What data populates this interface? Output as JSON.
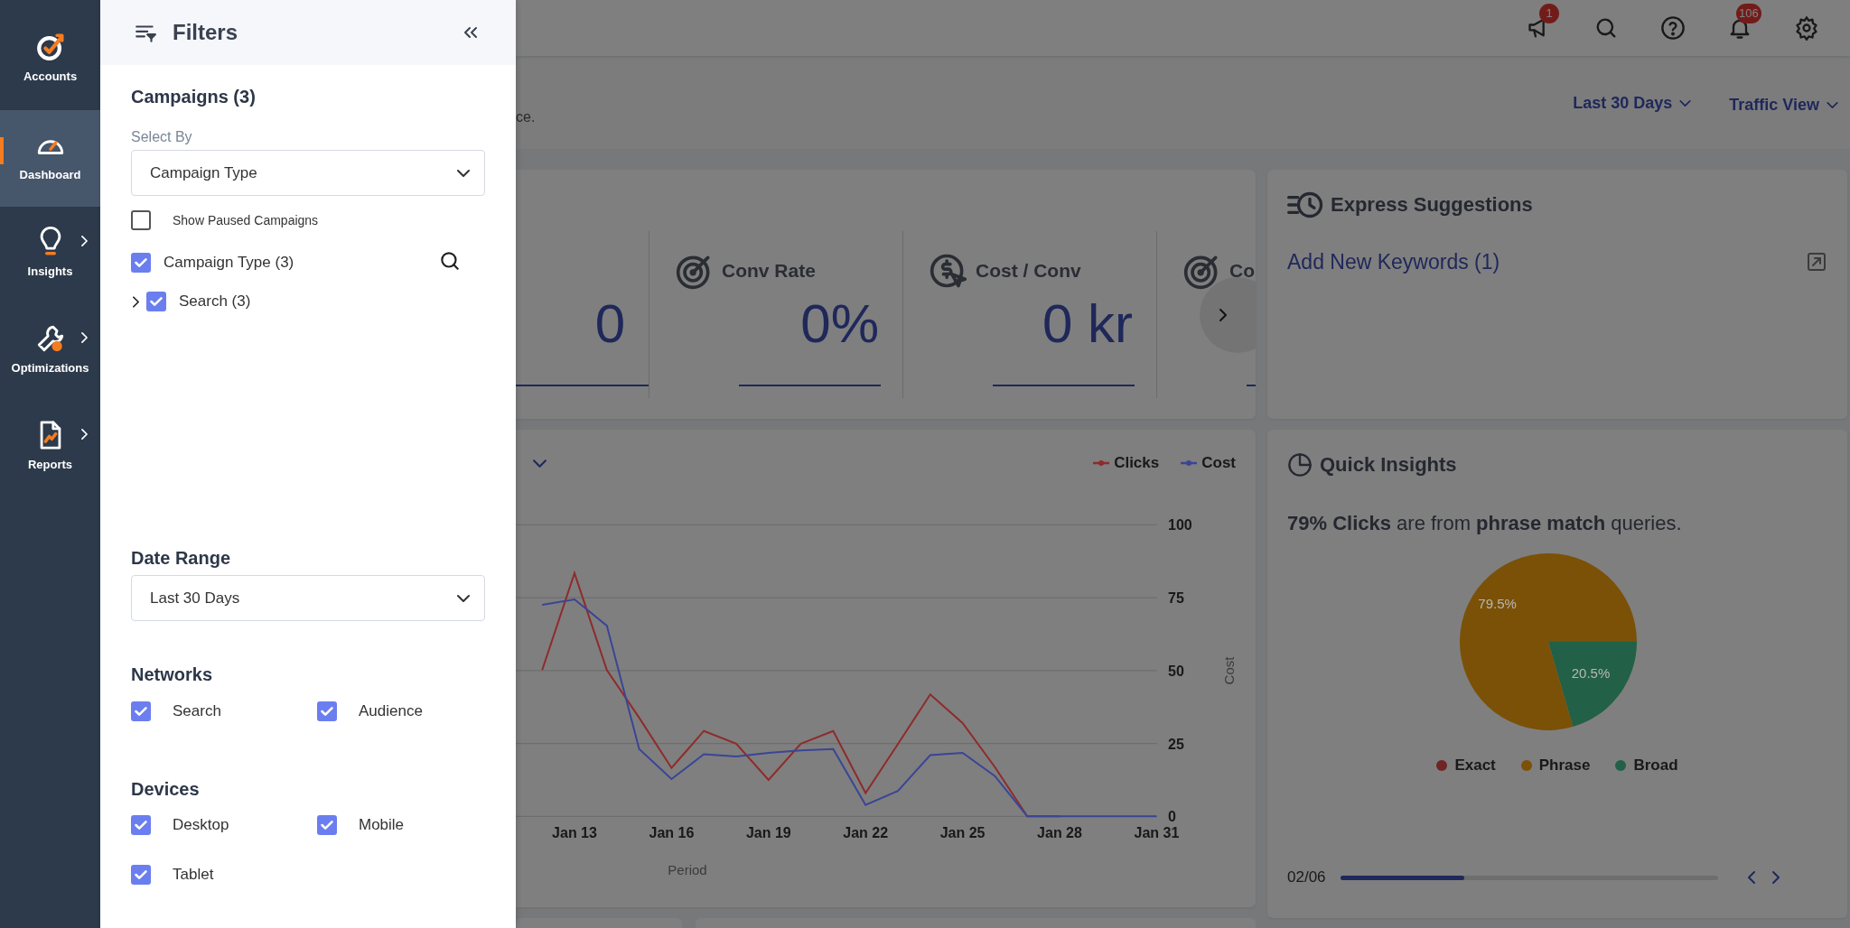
{
  "nav": [
    {
      "label": "Accounts",
      "selected": false,
      "submenu": false
    },
    {
      "label": "Dashboard",
      "selected": true,
      "submenu": false
    },
    {
      "label": "Insights",
      "selected": false,
      "submenu": true
    },
    {
      "label": "Optimizations",
      "selected": false,
      "submenu": true
    },
    {
      "label": "Reports",
      "selected": false,
      "submenu": true
    }
  ],
  "filters": {
    "title": "Filters",
    "campaigns": {
      "title": "Campaigns (3)",
      "select_by": {
        "label": "Select By",
        "value": "Campaign Type"
      },
      "show_paused": {
        "label": "Show Paused Campaigns",
        "checked": false
      },
      "tree": [
        {
          "label": "Campaign Type (3)",
          "checked": true,
          "children": [
            {
              "label": "Search (3)",
              "checked": true,
              "expanded": false
            }
          ]
        }
      ]
    },
    "date_range": {
      "title": "Date Range",
      "value": "Last 30 Days"
    },
    "networks": {
      "title": "Networks",
      "options": [
        {
          "label": "Search",
          "checked": true
        },
        {
          "label": "Audience",
          "checked": true
        }
      ]
    },
    "devices": {
      "title": "Devices",
      "options": [
        {
          "label": "Desktop",
          "checked": true
        },
        {
          "label": "Mobile",
          "checked": true
        },
        {
          "label": "Tablet",
          "checked": true
        }
      ]
    }
  },
  "topbar": {
    "messages_badge": "1",
    "notifications_badge": "106"
  },
  "header": {
    "description": "ce.",
    "date_range": "Last 30 Days",
    "view": "Traffic View"
  },
  "kpis": [
    {
      "value": "0"
    },
    {
      "label": "Conv Rate",
      "value": "0%"
    },
    {
      "label": "Cost / Conv",
      "value": "0 kr"
    },
    {
      "label": "Co"
    }
  ],
  "express": {
    "title": "Express Suggestions",
    "link": "Add New Keywords (1)"
  },
  "trend_chart": {
    "chart_data": {
      "type": "line",
      "xlabel": "Period",
      "ylabel": "Cost",
      "categories": [
        null,
        "Jan 13",
        null,
        null,
        "Jan 16",
        null,
        null,
        "Jan 19",
        null,
        null,
        "Jan 22",
        null,
        null,
        "Jan 25",
        null,
        null,
        "Jan 28",
        null,
        null,
        "Jan 31"
      ],
      "ylim": [
        0,
        100
      ],
      "yticks": [
        0,
        25,
        50,
        75,
        100
      ],
      "grid": true,
      "legend": "top-right",
      "series": [
        {
          "name": "Clicks",
          "color": "#8f2b2b",
          "values": [
            50.2,
            83.4,
            50.2,
            33.8,
            16.6,
            29.3,
            24.9,
            12.5,
            24.9,
            29.3,
            8,
            24.8,
            41.8,
            32,
            16.9,
            0,
            0,
            null,
            null,
            null
          ]
        },
        {
          "name": "Cost",
          "color": "#3a4596",
          "values": [
            72.5,
            74.4,
            65.4,
            23.1,
            12.8,
            21.3,
            20.5,
            21.8,
            22.6,
            23.1,
            3.9,
            8.7,
            21,
            21.8,
            13.8,
            0,
            0,
            0,
            0,
            0
          ]
        }
      ]
    }
  },
  "quick_insights": {
    "title": "Quick Insights",
    "summary": "**79% Clicks** are from **phrase match** queries.",
    "chart_data": {
      "type": "pie",
      "categories": [
        "Exact",
        "Phrase",
        "Broad"
      ],
      "values": [
        0,
        79.5,
        20.5
      ],
      "value_labels": [
        null,
        "79.5%",
        "20.5%"
      ]
    },
    "legend": [
      {
        "color": "#702424"
      },
      {
        "color": "#7a5107"
      },
      {
        "color": "#226047"
      }
    ],
    "pager": {
      "label": "02/06",
      "level": 0.33
    }
  }
}
